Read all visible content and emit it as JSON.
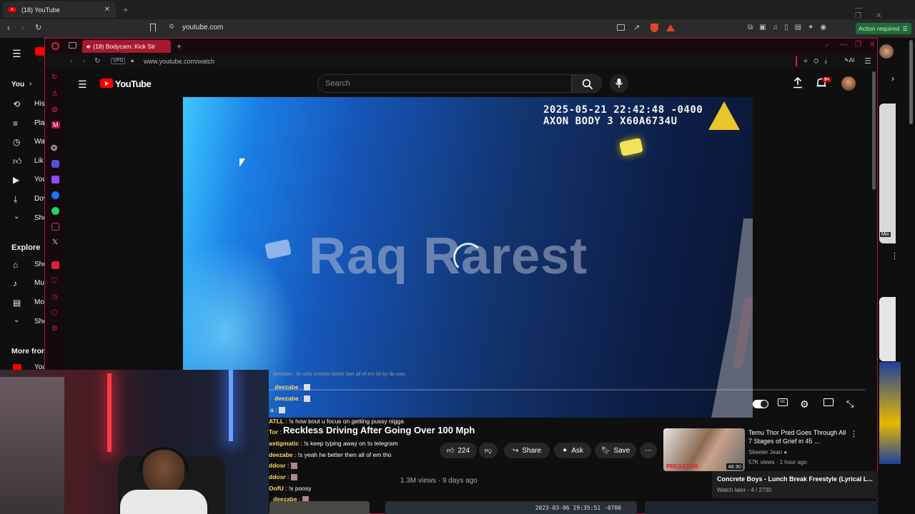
{
  "outer_browser": {
    "tab_title": "(18) YouTube",
    "url": "youtube.com",
    "action_required": "Action required"
  },
  "bg_youtube": {
    "you_label": "You",
    "items": [
      "His",
      "Pla",
      "Wa",
      "Lik",
      "You",
      "Dov",
      "Sho"
    ],
    "explore_label": "Explore",
    "explore_items": [
      "Sho",
      "Mu",
      "Mo",
      "Sho"
    ],
    "more_from": "More fron",
    "more_item": "You",
    "mix_badge": "Mix"
  },
  "inner_browser": {
    "tab_title": "(18) Bodycam: Kick Str",
    "vpn": "VPN",
    "url": "www.youtube.com/watch",
    "ai_label": "AI"
  },
  "youtube": {
    "logo_text": "YouTube",
    "search_placeholder": "Search",
    "notification_count": "9+"
  },
  "video": {
    "timestamp_line1": "2025-05-21 22:42:48 -0400",
    "timestamp_line2": "AXON BODY 3 X60A6734U",
    "watermark": "Raq Rarest",
    "title": "Reckless Driving After Going Over 100 Mph",
    "likes": "224",
    "share_label": "Share",
    "ask_label": "Ask",
    "save_label": "Save",
    "views_date": "1.3M views · 9 days ago"
  },
  "chat": [
    {
      "user": "",
      "text": "deezabe : its only chicken better ban all of em lol by da way"
    },
    {
      "user": "deezabe",
      "text": " : "
    },
    {
      "user": "deezabe",
      "text": " : "
    },
    {
      "user": "a",
      "text": " : "
    },
    {
      "user": "ATLL",
      "text": " : !s how bout u focus on getting pussy nigga"
    },
    {
      "user": "Tor",
      "text": " : "
    },
    {
      "user": "astigmatic",
      "text": " : !s keep typing away on to telegram"
    },
    {
      "user": "deezabe",
      "text": " : !s yeah he better then all of em tho"
    },
    {
      "user": "ddosr",
      "text": " : "
    },
    {
      "user": "ddosr",
      "text": " : "
    },
    {
      "user": "OofU",
      "text": " : !s poosy"
    },
    {
      "user": "deezabe",
      "text": " : "
    },
    {
      "user": "deezabe",
      "text": " : "
    }
  ],
  "recommended": {
    "title": "Temu Thor Pred Goes Through All 7 Stages of Grief in 45 ...",
    "channel": "Skeeter Jean",
    "meta": "57K views · 1 hour ago",
    "duration": "46:30",
    "thumb_text": "PREDATOR"
  },
  "watch_later": {
    "title": "Concrete Boys - Lunch Break Freestyle (Lyrical L...",
    "sub": "Watch later - 4 / 2730"
  },
  "bottom_thumb_timestamp": "2023-03-06 19:35:51 -0700",
  "colors": {
    "accent_red": "#ff0000",
    "opera_red": "#b01040",
    "action_green": "#1f6b3a"
  }
}
